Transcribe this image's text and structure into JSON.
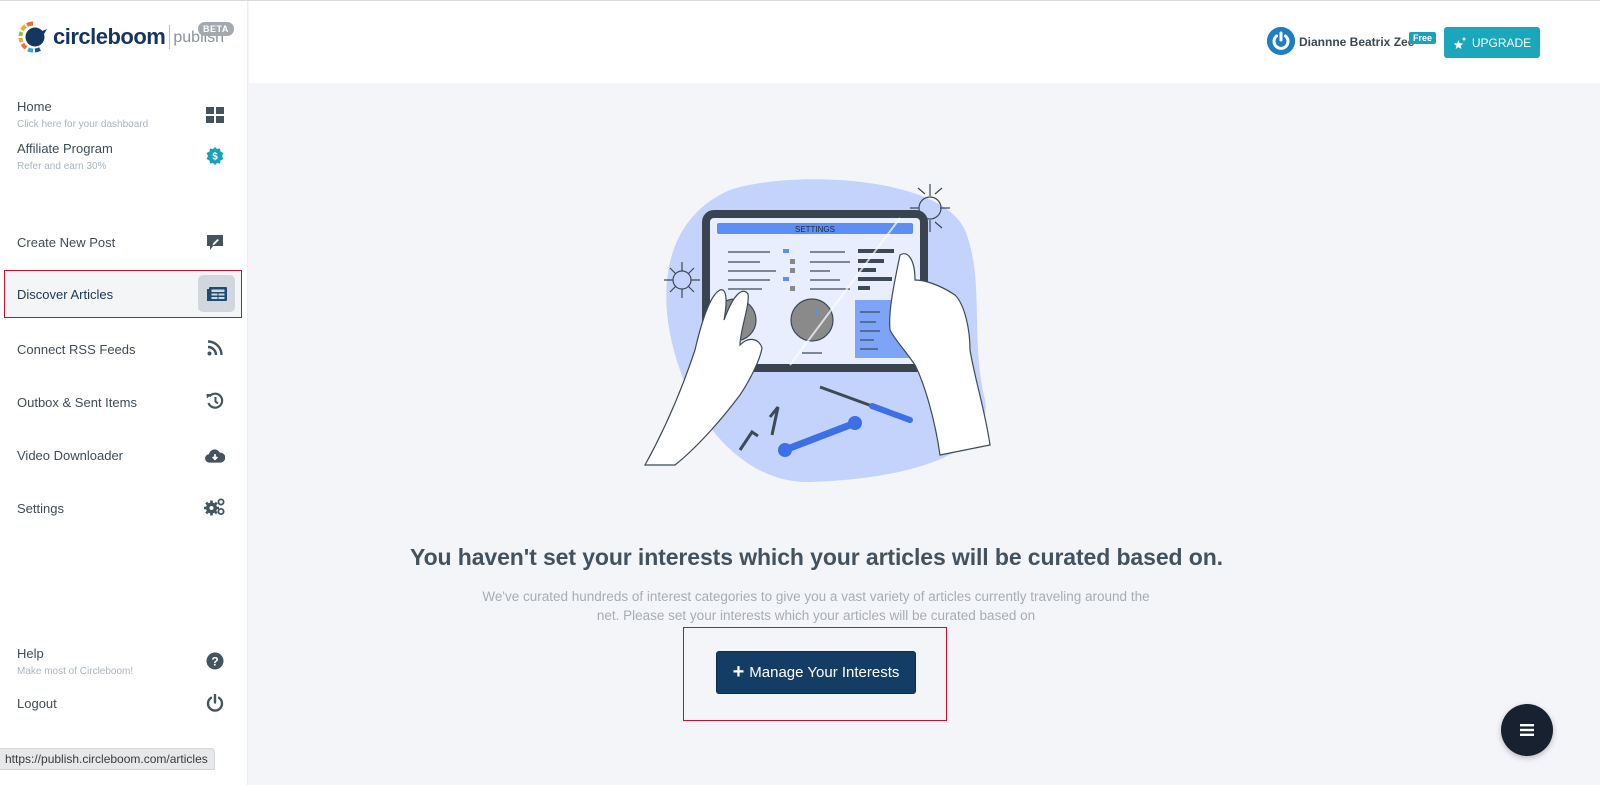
{
  "brand": {
    "name": "circleboom",
    "product": "publish",
    "badge": "BETA"
  },
  "sidebar": {
    "top_items": [
      {
        "label": "Home",
        "sub": "Click here for your dashboard",
        "icon": "grid-icon"
      },
      {
        "label": "Affiliate Program",
        "sub": "Refer and earn 30%",
        "icon": "dollar-badge-icon"
      }
    ],
    "items": [
      {
        "label": "Create New Post",
        "icon": "edit-comment-icon"
      },
      {
        "label": "Discover Articles",
        "icon": "newspaper-icon",
        "active": true
      },
      {
        "label": "Connect RSS Feeds",
        "icon": "rss-icon"
      },
      {
        "label": "Outbox & Sent Items",
        "icon": "history-icon"
      },
      {
        "label": "Video Downloader",
        "icon": "cloud-download-icon"
      },
      {
        "label": "Settings",
        "icon": "cogs-icon"
      }
    ],
    "bottom_items": [
      {
        "label": "Help",
        "sub": "Make most of Circleboom!",
        "icon": "question-circle-icon"
      },
      {
        "label": "Logout",
        "icon": "power-icon"
      }
    ]
  },
  "status_bar": {
    "url": "https://publish.circleboom.com/articles"
  },
  "header": {
    "user_name": "Diannne Beatrix Zee",
    "plan_badge": "Free",
    "upgrade_label": "UPGRADE"
  },
  "main": {
    "illustration_label": "SETTINGS",
    "headline": "You haven't set your interests which your articles will be curated based on.",
    "subtext": "We've curated hundreds of interest categories to give you a vast variety of articles currently traveling around the net. Please set your interests which your articles will be curated based on",
    "cta_label": "Manage Your Interests"
  },
  "colors": {
    "brand_navy": "#16365f",
    "accent_teal": "#1aa7bb",
    "cta_navy": "#143d66",
    "highlight_red": "#c8102e"
  }
}
